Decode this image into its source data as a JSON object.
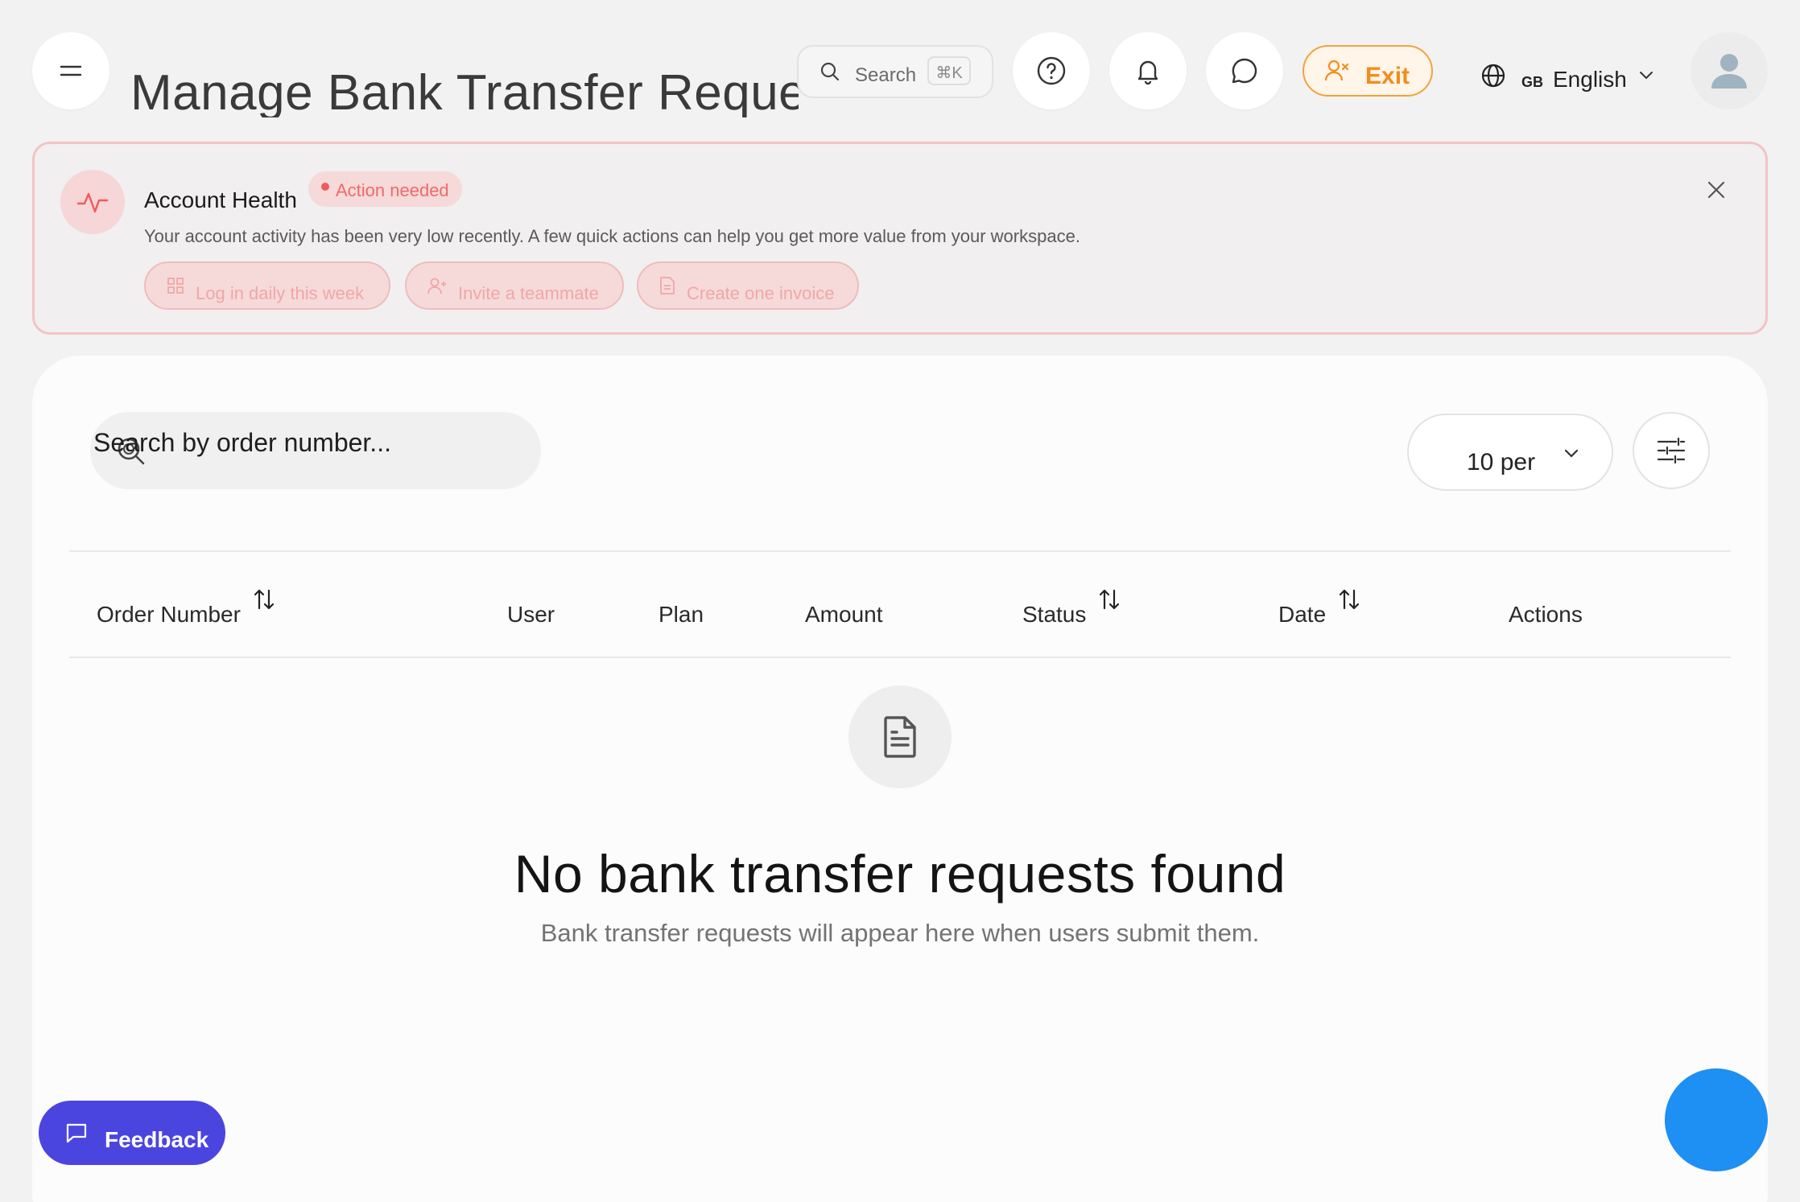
{
  "header": {
    "title": "Manage Bank Transfer Reque",
    "search_label": "Search",
    "search_shortcut": "⌘K",
    "exit_label": "Exit",
    "language_code": "GB",
    "language_name": "English"
  },
  "account_health": {
    "title": "Account Health",
    "badge": "Action needed",
    "description": "Your account activity has been very low recently. A few quick actions can help you get more value from your workspace.",
    "actions": [
      {
        "label": "Log in daily this week",
        "icon": "grid-icon"
      },
      {
        "label": "Invite a teammate",
        "icon": "user-plus-icon"
      },
      {
        "label": "Create one invoice",
        "icon": "file-icon"
      }
    ]
  },
  "table": {
    "search_placeholder": "Search by order number...",
    "per_page": "10 per",
    "columns": [
      {
        "label": "Order Number",
        "sortable": true
      },
      {
        "label": "User",
        "sortable": false
      },
      {
        "label": "Plan",
        "sortable": false
      },
      {
        "label": "Amount",
        "sortable": false
      },
      {
        "label": "Status",
        "sortable": true
      },
      {
        "label": "Date",
        "sortable": true
      },
      {
        "label": "Actions",
        "sortable": false
      }
    ]
  },
  "empty_state": {
    "title": "No bank transfer requests found",
    "subtitle": "Bank transfer requests will appear here when users submit them."
  },
  "feedback_label": "Feedback",
  "colors": {
    "accent_orange": "#f28c1c",
    "alert_red": "#ef6a6a",
    "feedback_purple": "#4b45e0",
    "fab_blue": "#1e8ff3"
  }
}
